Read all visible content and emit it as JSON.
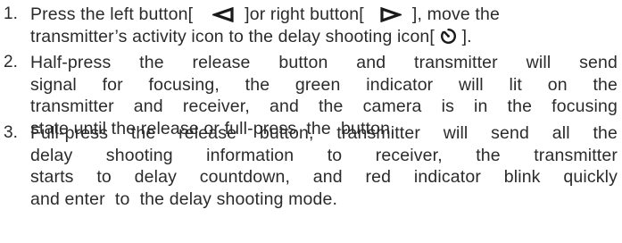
{
  "steps": [
    {
      "number": "1.",
      "lines": [
        {
          "parts": [
            "Press the left button[",
            "]or right button[",
            "], move the"
          ],
          "icons": [
            "triangle-left-icon",
            "triangle-right-icon"
          ]
        },
        {
          "parts": [
            "transmitter’s activity icon to the delay shooting  icon[",
            " ]."
          ],
          "icons": [
            "delay-timer-icon"
          ]
        }
      ]
    },
    {
      "number": "2.",
      "lines": [
        "Half-press the release button and transmitter will send",
        "signal for focusing, the green indicator will lit on the",
        "transmitter and receiver, and the camera is in the focusing",
        "state until the release or full-press  the  button."
      ]
    },
    {
      "number": "3.",
      "lines": [
        "Full-press the release button, transmitter will send all the",
        "delay shooting information to receiver, the transmitter",
        "starts to delay countdown, and red indicator blink quickly",
        "and enter  to  the delay shooting mode."
      ]
    }
  ]
}
